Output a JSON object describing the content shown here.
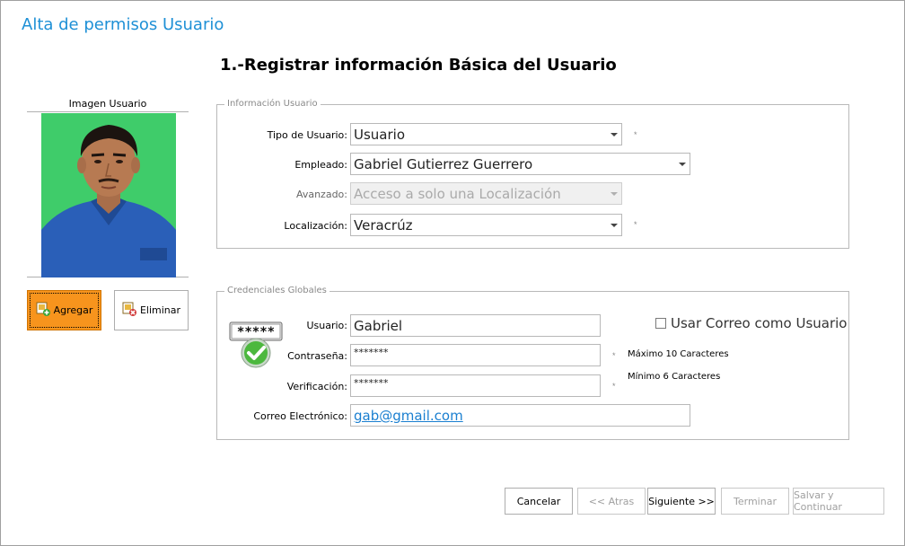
{
  "window": {
    "title": "Alta de permisos Usuario"
  },
  "page": {
    "heading": "1.-Registrar información Básica del Usuario"
  },
  "photo": {
    "label": "Imagen Usuario",
    "background": "#3fcc6a"
  },
  "photo_buttons": {
    "add_label": "Agregar",
    "delete_label": "Eliminar"
  },
  "info_group": {
    "legend": "Información Usuario",
    "tipo_label": "Tipo de Usuario:",
    "tipo_value": "Usuario",
    "empleado_label": "Empleado:",
    "empleado_value": "Gabriel Gutierrez Guerrero",
    "avanzado_label": "Avanzado:",
    "avanzado_value": "Acceso a solo una Localización",
    "localizacion_label": "Localización:",
    "localizacion_value": "Veracrúz",
    "required_mark": "*"
  },
  "cred_group": {
    "legend": "Credenciales Globales",
    "icon_text": "*****",
    "usuario_label": "Usuario:",
    "usuario_value": "Gabriel",
    "use_email_label": "Usar Correo como Usuario",
    "password_label": "Contraseña:",
    "password_value": "*******",
    "verify_label": "Verificación:",
    "verify_value": "*******",
    "email_label": "Correo Electrónico:",
    "email_value": "gab@gmail.com",
    "max_hint": "Máximo 10 Caracteres",
    "min_hint": "Mínimo 6 Caracteres",
    "required_mark": "*"
  },
  "footer": {
    "cancel": "Cancelar",
    "back": "<< Atras",
    "next": "Siguiente >>",
    "finish": "Terminar",
    "save_continue": "Salvar y Continuar"
  },
  "colors": {
    "accent": "#1e90d6",
    "add_button": "#f7941d",
    "link": "#1a7fd0"
  }
}
